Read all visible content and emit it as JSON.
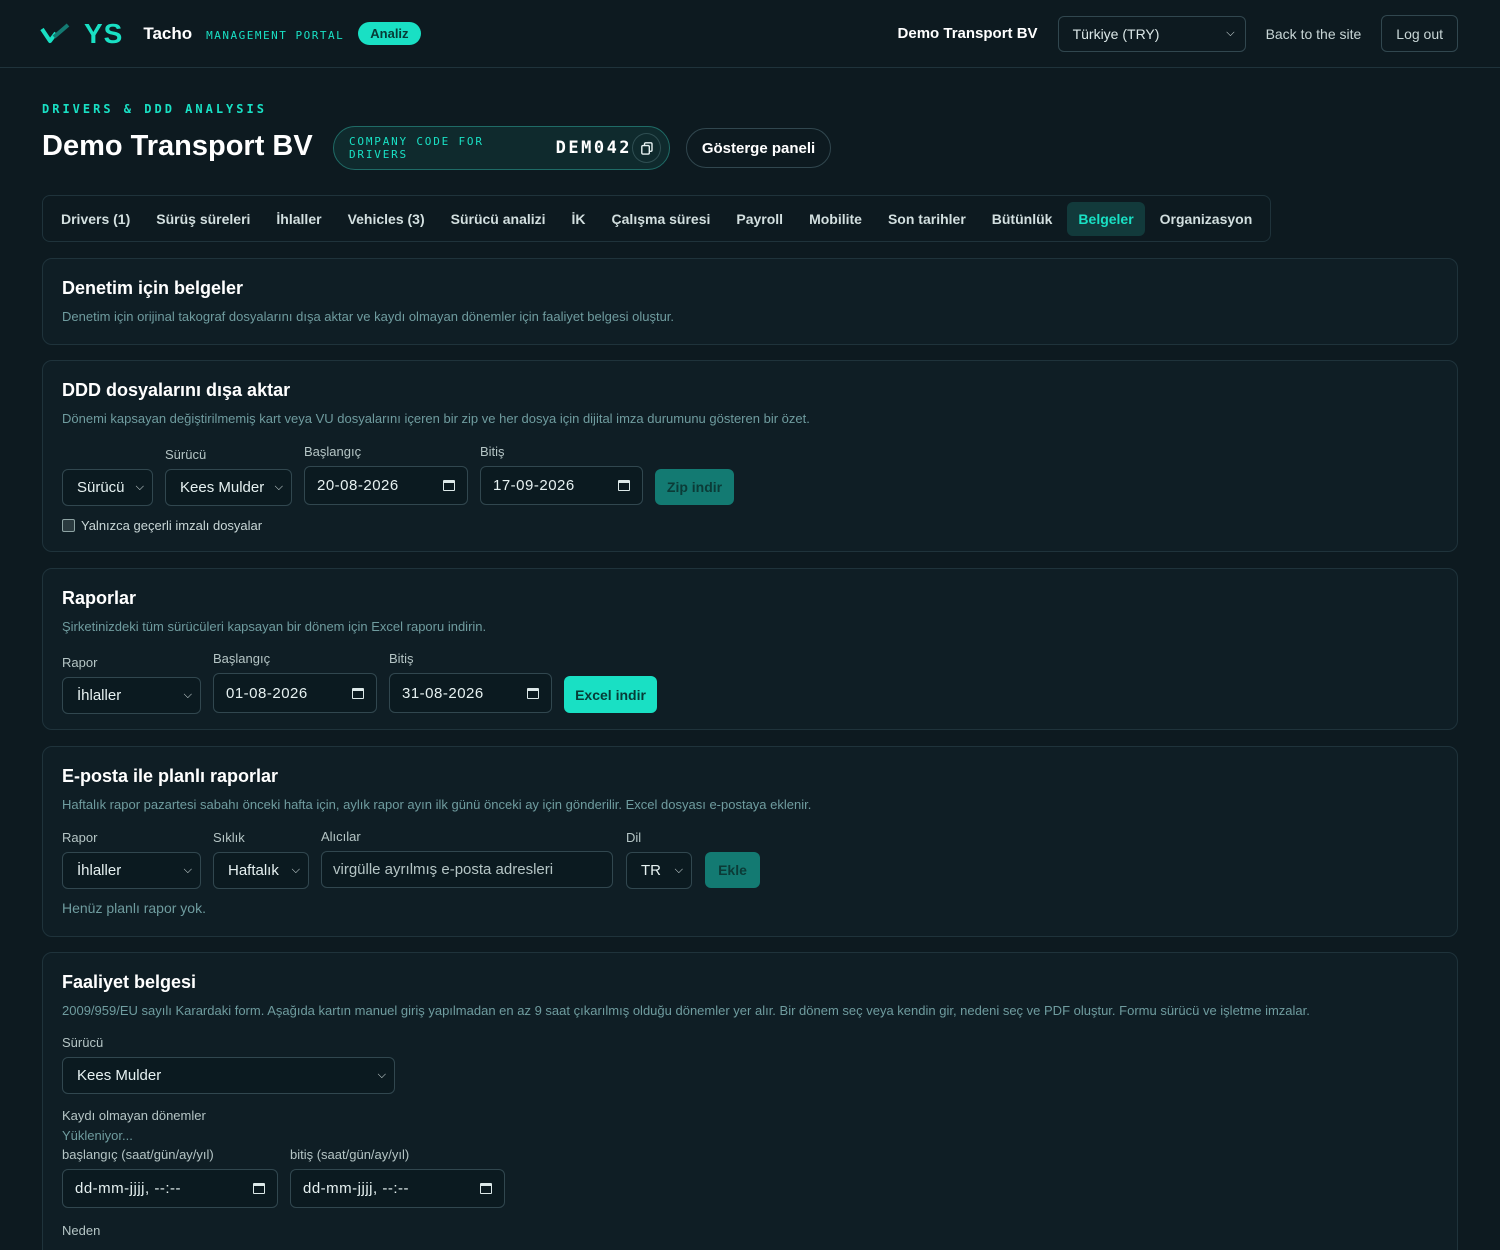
{
  "header": {
    "logo_ys": "YS",
    "logo_tacho": "Tacho",
    "logo_sub": "MANAGEMENT PORTAL",
    "badge": "Analiz",
    "company": "Demo Transport BV",
    "currency": "Türkiye (TRY)",
    "back_link": "Back to the site",
    "logout": "Log out"
  },
  "page": {
    "kicker": "DRIVERS & DDD ANALYSIS",
    "title": "Demo Transport BV",
    "code_label": "COMPANY CODE FOR DRIVERS",
    "code_value": "DEM042",
    "dashboard_button": "Gösterge paneli"
  },
  "tabs": [
    {
      "label": "Drivers (1)"
    },
    {
      "label": "Sürüş süreleri"
    },
    {
      "label": "İhlaller"
    },
    {
      "label": "Vehicles (3)"
    },
    {
      "label": "Sürücü analizi"
    },
    {
      "label": "İK"
    },
    {
      "label": "Çalışma süresi"
    },
    {
      "label": "Payroll"
    },
    {
      "label": "Mobilite"
    },
    {
      "label": "Son tarihler"
    },
    {
      "label": "Bütünlük"
    },
    {
      "label": "Belgeler",
      "active": true
    },
    {
      "label": "Organizasyon"
    }
  ],
  "audit": {
    "title": "Denetim için belgeler",
    "desc": "Denetim için orijinal takograf dosyalarını dışa aktar ve kaydı olmayan dönemler için faaliyet belgesi oluştur."
  },
  "ddd_export": {
    "title": "DDD dosyalarını dışa aktar",
    "desc": "Dönemi kapsayan değiştirilmemiş kart veya VU dosyalarını içeren bir zip ve her dosya için dijital imza durumunu gösteren bir özet.",
    "type_select": "Sürücü",
    "driver_label": "Sürücü",
    "driver_select": "Kees Mulder",
    "start_label": "Başlangıç",
    "start_value": "20-08-2026",
    "end_label": "Bitiş",
    "end_value": "17-09-2026",
    "zip_button": "Zip indir",
    "checkbox_label": "Yalnızca geçerli imzalı dosyalar"
  },
  "reports": {
    "title": "Raporlar",
    "desc": "Şirketinizdeki tüm sürücüleri kapsayan bir dönem için Excel raporu indirin.",
    "report_label": "Rapor",
    "report_select": "İhlaller",
    "start_label": "Başlangıç",
    "start_value": "01-08-2026",
    "end_label": "Bitiş",
    "end_value": "31-08-2026",
    "excel_button": "Excel indir"
  },
  "scheduled": {
    "title": "E-posta ile planlı raporlar",
    "desc": "Haftalık rapor pazartesi sabahı önceki hafta için, aylık rapor ayın ilk günü önceki ay için gönderilir. Excel dosyası e-postaya eklenir.",
    "report_label": "Rapor",
    "report_select": "İhlaller",
    "freq_label": "Sıklık",
    "freq_select": "Haftalık",
    "recipients_label": "Alıcılar",
    "recipients_placeholder": "virgülle ayrılmış e-posta adresleri",
    "lang_label": "Dil",
    "lang_select": "TR",
    "add_button": "Ekle",
    "empty": "Henüz planlı rapor yok."
  },
  "activity": {
    "title": "Faaliyet belgesi",
    "desc": "2009/959/EU sayılı Karardaki form. Aşağıda kartın manuel giriş yapılmadan en az 9 saat çıkarılmış olduğu dönemler yer alır. Bir dönem seç veya kendin gir, nedeni seç ve PDF oluştur. Formu sürücü ve işletme imzalar.",
    "driver_label": "Sürücü",
    "driver_select": "Kees Mulder",
    "periods_label": "Kaydı olmayan dönemler",
    "loading": "Yükleniyor...",
    "start_label": "başlangıç (saat/gün/ay/yıl)",
    "start_placeholder": "dd-mm-jjjj, --:--",
    "end_label": "bitiş (saat/gün/ay/yıl)",
    "end_placeholder": "dd-mm-jjjj, --:--",
    "reason_label": "Neden"
  },
  "colors": {
    "background": "#0d1a20",
    "accent": "#19e0c4",
    "card": "#0f1e25",
    "border": "#1f333b"
  }
}
